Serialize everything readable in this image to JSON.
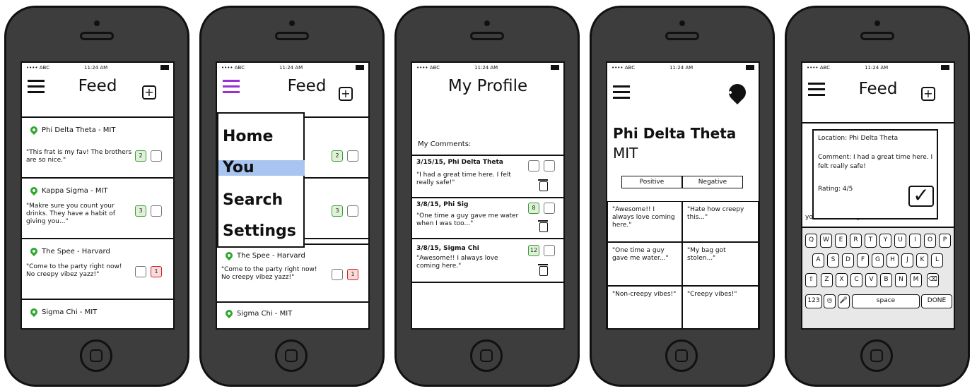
{
  "status": {
    "carrier": "•••• ABC",
    "time": "11:24 AM"
  },
  "feed": {
    "title": "Feed",
    "plus_label": "+",
    "posts": [
      {
        "location": "Phi Delta Theta - MIT",
        "quote": "\"This frat is my fav! The brothers are so nice.\"",
        "up": "2"
      },
      {
        "location": "Kappa Sigma - MIT",
        "quote": "\"Makre sure you count your drinks. They have a habit of giving you...\"",
        "up": "3"
      },
      {
        "location": "The Spee - Harvard",
        "quote": "\"Come to the party right now! No creepy vibez yazz!\"",
        "down": "1"
      },
      {
        "location": "Sigma Chi - MIT"
      }
    ]
  },
  "menu": {
    "items": [
      "Home",
      "You",
      "Search",
      "Settings"
    ]
  },
  "profile": {
    "title": "My Profile",
    "comments_label": "My Comments:",
    "comments": [
      {
        "head": "3/15/15, Phi Delta Theta",
        "quote": "\"I had a great time here. I felt really safe!\""
      },
      {
        "head": "3/8/15, Phi Sig",
        "quote": "\"One time a guy gave me water when I was too...\"",
        "up": "8"
      },
      {
        "head": "3/8/15, Sigma Chi",
        "quote": "\"Awesome!! I always love coming here.\"",
        "up": "12"
      }
    ]
  },
  "house": {
    "name": "Phi Delta Theta",
    "school": "MIT",
    "positive_label": "Positive",
    "negative_label": "Negative",
    "positive": [
      "\"Awesome!! I always love coming here.\"",
      "\"One time a guy gave me water...\"",
      "\"Non-creepy vibes!\""
    ],
    "negative": [
      "\"Hate how creepy this...\"",
      "\"My bag got stolen...\"",
      "\"Creepy vibes!\""
    ]
  },
  "compose": {
    "title": "Feed",
    "location": "Location: Phi Delta Theta",
    "comment": "Comment: I had a great time here. I felt really safe!",
    "rating": "Rating: 4/5",
    "partial_text": "your drinks. They have a",
    "keys_row1": [
      "Q",
      "W",
      "E",
      "R",
      "T",
      "Y",
      "U",
      "I",
      "O",
      "P"
    ],
    "keys_row2": [
      "A",
      "S",
      "D",
      "F",
      "G",
      "H",
      "J",
      "K",
      "L"
    ],
    "keys_row3": [
      "Z",
      "X",
      "C",
      "V",
      "B",
      "N",
      "M"
    ],
    "key_123": "123",
    "key_space": "space",
    "key_done": "DONE"
  }
}
